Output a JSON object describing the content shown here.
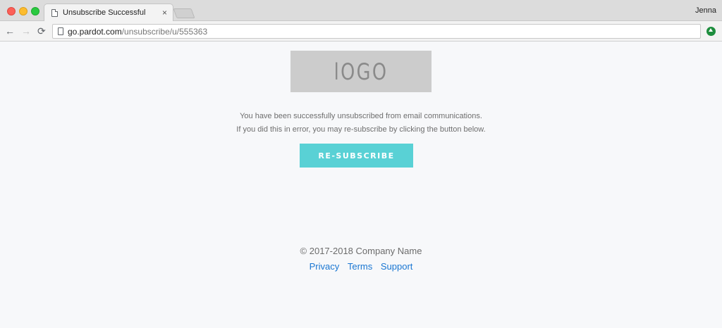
{
  "browser": {
    "tab_title": "Unsubscribe Successful",
    "tab_close": "×",
    "profile_name": "Jenna",
    "url_host": "go.pardot.com",
    "url_path": "/unsubscribe/u/555363"
  },
  "page": {
    "logo_text": "lOGO",
    "message_line1": "You have been successfully unsubscribed from email communications.",
    "message_line2": "If you did this in error, you may re-subscribe by clicking the button below.",
    "resubscribe_label": "RE-SUBSCRIBE",
    "copyright": "© 2017-2018 Company Name",
    "footer_links": [
      "Privacy",
      "Terms",
      "Support"
    ]
  },
  "colors": {
    "button": "#59d1d5",
    "link": "#1976d2",
    "logo_bg": "#cccccc"
  }
}
